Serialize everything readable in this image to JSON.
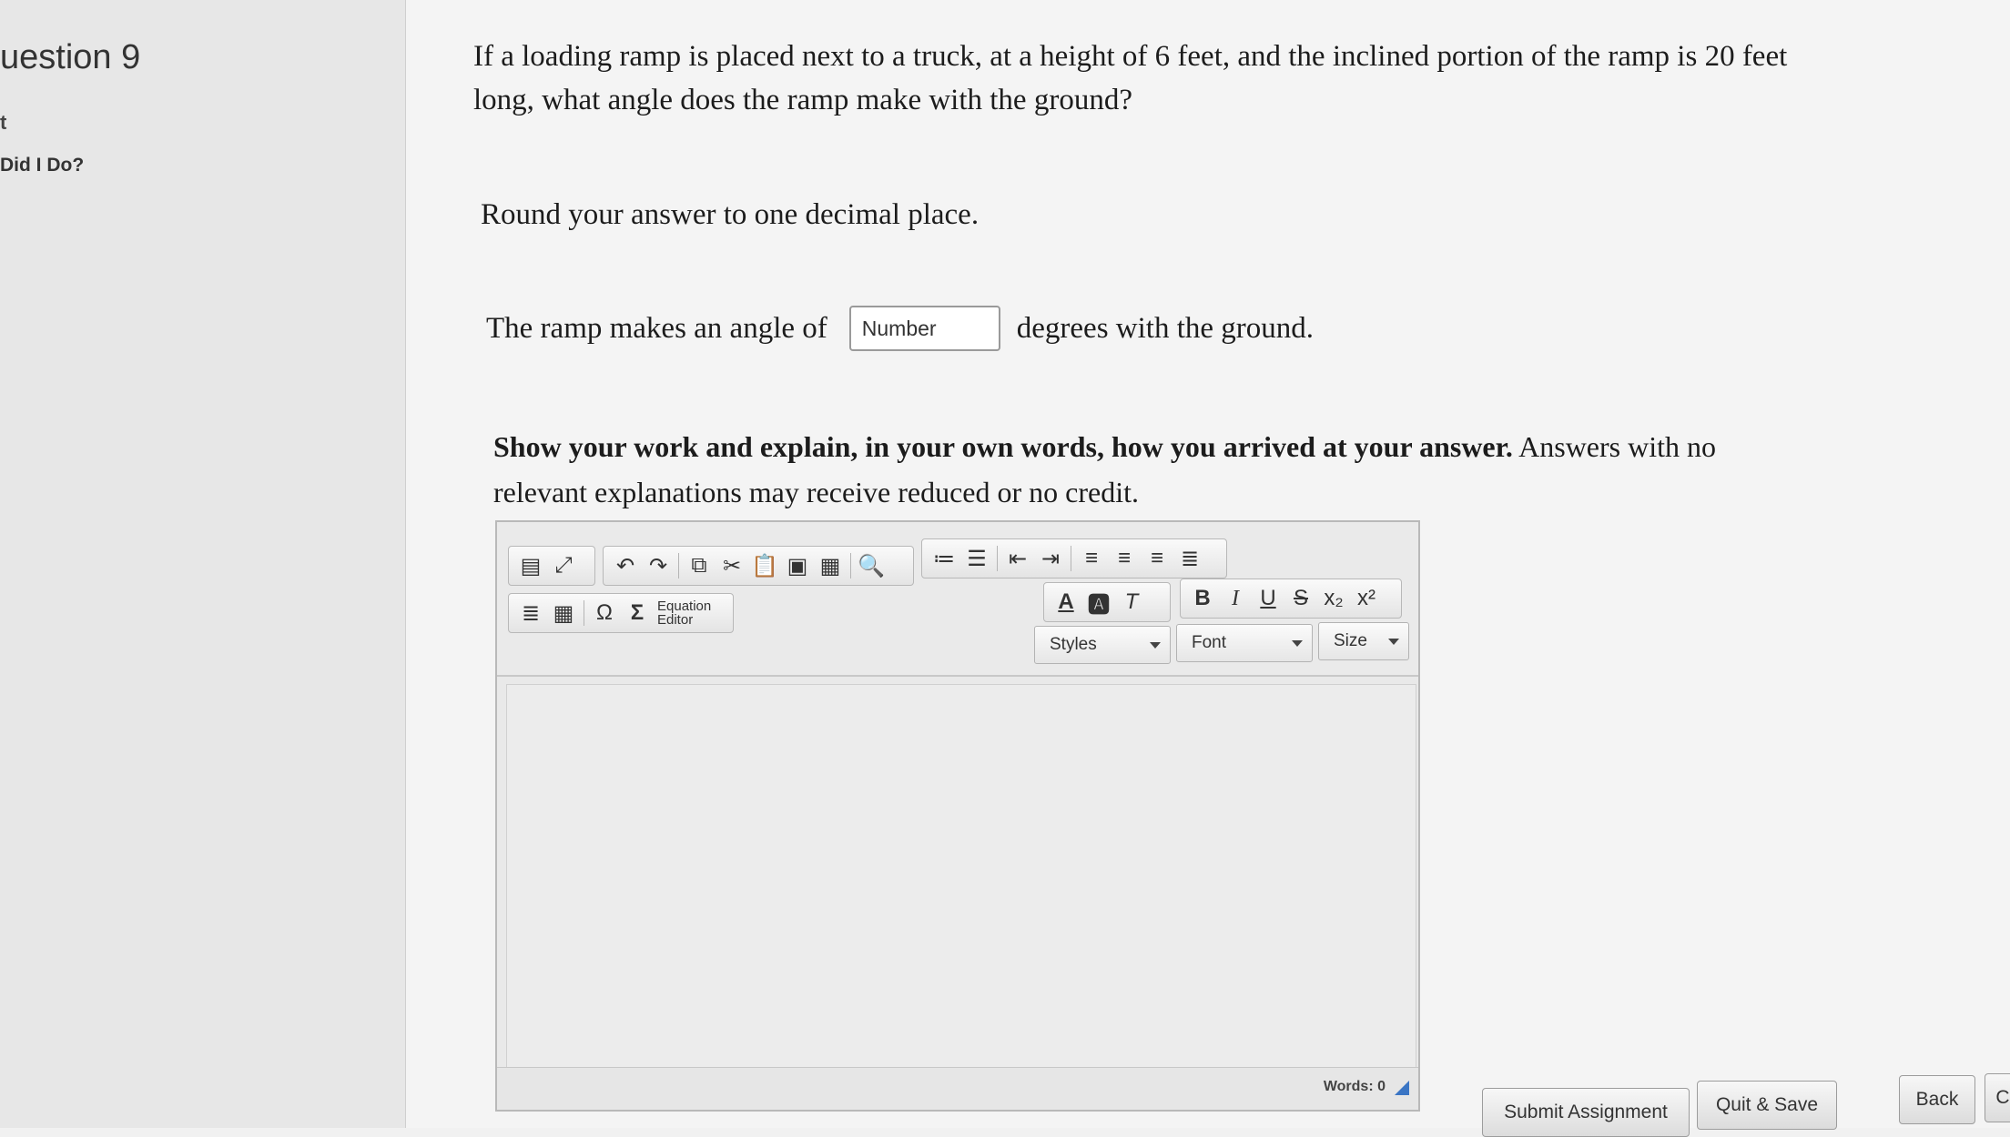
{
  "sidebar": {
    "question_title": "uestion 9",
    "points_fragment": "t",
    "how_did_i_do": "Did I Do?"
  },
  "question": {
    "text": "If a loading ramp is placed next to a truck, at a height of 6 feet, and the inclined portion of the ramp is 20 feet long, what angle does the ramp make with the ground?",
    "round_instruction": "Round your answer to one decimal place.",
    "answer_prefix": "The ramp makes an angle of",
    "answer_placeholder": "Number",
    "answer_suffix": "degrees with the ground."
  },
  "instructions": {
    "bold_part": "Show your work and explain, in your own words, how you arrived at your answer.",
    "normal_part": " Answers with no relevant explanations may receive reduced or no credit."
  },
  "editor": {
    "equation_editor_label_1": "Equation",
    "equation_editor_label_2": "Editor",
    "styles_label": "Styles",
    "font_label": "Font",
    "size_label": "Size",
    "word_count": "Words: 0"
  },
  "buttons": {
    "submit": "Submit Assignment",
    "quit_save": "Quit & Save",
    "back": "Back",
    "next_fragment": "C"
  }
}
